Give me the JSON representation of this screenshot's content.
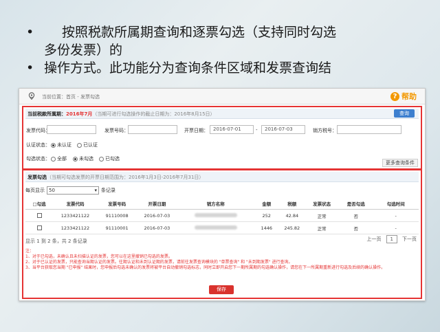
{
  "slide": {
    "bullet1_line1": "按照税款所属期查询和逐票勾选（支持同时勾选",
    "bullet1_line2": "多份发票）的",
    "bullet2": "操作方式。此功能分为查询条件区域和发票查询结",
    "bullet_char": "•"
  },
  "topbar": {
    "crumb": "当前位置：首页 - 发票勾选",
    "help_label": "帮助",
    "help_glyph": "?"
  },
  "query": {
    "title_prefix": "当前税款所属期：",
    "period": "2016年7月",
    "note": "（当期可进行勾选操作的截止日期为：2016年8月15日）",
    "query_button": "查询",
    "invoice_code_label": "发票代码：",
    "invoice_no_label": "发票号码：",
    "date_label": "开票日期：",
    "date_from": "2016-07-01",
    "date_sep": "-",
    "date_to": "2016-07-03",
    "seller_tax_label": "销方税号：",
    "auth_status_label": "认证状态：",
    "auth_options": [
      "未认证",
      "已认证"
    ],
    "check_status_label": "勾选状态：",
    "check_options": [
      "全部",
      "未勾选",
      "已勾选"
    ],
    "more_button": "更多查询条件"
  },
  "invoices": {
    "title": "发票勾选",
    "note": "（当期可勾选发票的开票日期范围为：2016年1月3日-2016年7月31日）",
    "perpage_label": "每页显示",
    "perpage_value": "50",
    "perpage_suffix": "条记录",
    "columns": [
      "□勾选",
      "发票代码",
      "发票号码",
      "开票日期",
      "销方名称",
      "金额",
      "税额",
      "发票状态",
      "是否勾选",
      "勾选时间"
    ],
    "rows": [
      {
        "code": "1233421122",
        "number": "91110008",
        "date": "2016-07-03",
        "amount": "252",
        "tax": "42.84",
        "status": "正常",
        "checked": "否",
        "time": "-"
      },
      {
        "code": "1233421122",
        "number": "91110001",
        "date": "2016-07-03",
        "amount": "1446",
        "tax": "245.82",
        "status": "正常",
        "checked": "否",
        "time": "-"
      }
    ],
    "summary": "显示 1 到 2 条，共 2 条记录",
    "prev": "上一页",
    "page": "1",
    "next": "下一页",
    "notes_title": "注：",
    "notes": [
      "1、对于已勾选，未确认且未扫描认证的发票，您可以在这里撤销已勾选的发票。",
      "2、对于已认证的发票，只能查询当期认证的发票。往期认证和未到认证期的发票，请前往发票查询模块的 \"单票查询\" 和 \"未到期发票\" 进行查询。",
      "3、当平台获取您当期 \"已申报\" 结果时，您申报后勾选未确认的发票将被平台自动撤销勾选标志，同时立即开启您下一期所属期的勾选确认操作，请您在下一所属期重新进行勾选及后续的确认操作。"
    ],
    "save_button": "保存"
  },
  "colors": {
    "accent_red": "#e53333",
    "query_blue": "#3d7fcf",
    "help_orange": "#f39800"
  }
}
